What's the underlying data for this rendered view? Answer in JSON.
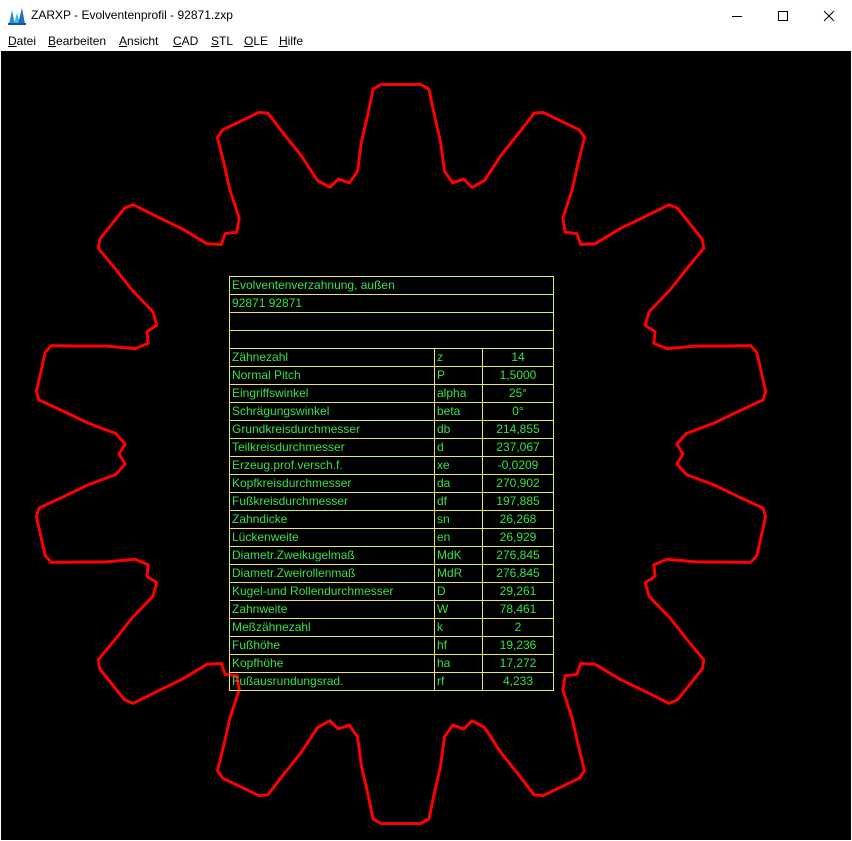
{
  "window": {
    "title": "ZARXP - Evolventenprofil  -  92871.zxp",
    "icon": "zarxp-app-icon",
    "controls": [
      "minimize-icon",
      "maximize-icon",
      "close-icon"
    ]
  },
  "menu": [
    {
      "mnemonic": "D",
      "rest": "atei"
    },
    {
      "mnemonic": "B",
      "rest": "earbeiten"
    },
    {
      "mnemonic": "A",
      "rest": "nsicht"
    },
    {
      "mnemonic": "C",
      "rest": "AD"
    },
    {
      "mnemonic": "S",
      "rest": "TL"
    },
    {
      "mnemonic": "O",
      "rest": "LE"
    },
    {
      "mnemonic": "H",
      "rest": "ilfe"
    }
  ],
  "colors": {
    "canvas_background": "#000000",
    "gear_outline": "#ff0000",
    "table_text": "#36e24a",
    "table_grid": "#e8e85a"
  },
  "gear": {
    "teeth": 14
  },
  "table": {
    "header": [
      "Evolventenverzahnung, außen",
      "92871 92871",
      "",
      ""
    ],
    "rows": [
      {
        "name": "Zähnezahl",
        "symbol": "z",
        "value": "14"
      },
      {
        "name": "Normal Pitch",
        "symbol": "P",
        "value": "1,5000"
      },
      {
        "name": "Eingriffswinkel",
        "symbol": "alpha",
        "value": "25°"
      },
      {
        "name": "Schrägungswinkel",
        "symbol": "beta",
        "value": "0°"
      },
      {
        "name": "Grundkreisdurchmesser",
        "symbol": "db",
        "value": "214,855"
      },
      {
        "name": "Teilkreisdurchmesser",
        "symbol": "d",
        "value": "237,067"
      },
      {
        "name": "Erzeug.prof.versch.f.",
        "symbol": "xe",
        "value": "-0,0209"
      },
      {
        "name": "Kopfkreisdurchmesser",
        "symbol": "da",
        "value": "270,902"
      },
      {
        "name": "Fußkreisdurchmesser",
        "symbol": "df",
        "value": "197,885"
      },
      {
        "name": "Zahndicke",
        "symbol": "sn",
        "value": "26,268"
      },
      {
        "name": "Lückenweite",
        "symbol": "en",
        "value": "26,929"
      },
      {
        "name": "Diametr.Zweikugelmaß",
        "symbol": "MdK",
        "value": "276,845"
      },
      {
        "name": "Diametr.Zweirollenmaß",
        "symbol": "MdR",
        "value": "276,845"
      },
      {
        "name": "Kugel-und Rollendurchmesser",
        "symbol": "D",
        "value": "29,261"
      },
      {
        "name": "Zahnweite",
        "symbol": "W",
        "value": "78,461"
      },
      {
        "name": "Meßzähnezahl",
        "symbol": "k",
        "value": "2"
      },
      {
        "name": "Fußhöhe",
        "symbol": "hf",
        "value": "19,236"
      },
      {
        "name": "Kopfhöhe",
        "symbol": "ha",
        "value": "17,272"
      },
      {
        "name": "Fußausrundungsrad.",
        "symbol": "rf",
        "value": "4,233"
      }
    ]
  }
}
